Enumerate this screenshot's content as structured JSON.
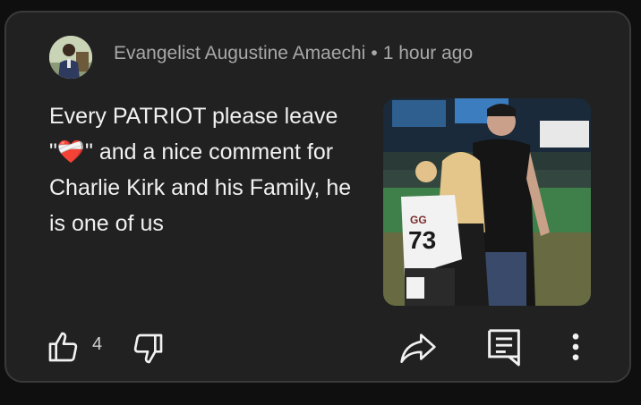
{
  "comment": {
    "author": "Evangelist Augustine Amaechi",
    "separator": "•",
    "timestamp": "1 hour ago",
    "text_before_emoji": "Every PATRIOT please leave \"",
    "emoji": "❤️‍🩹",
    "text_after_emoji": "\" and a nice comment for Charlie Kirk and his Family, he is one of us"
  },
  "actions": {
    "like_count": "4"
  },
  "icons": {
    "like": "thumbs-up-icon",
    "dislike": "thumbs-down-icon",
    "share": "share-arrow-icon",
    "reply": "reply-comment-icon",
    "more": "more-vertical-icon"
  },
  "colors": {
    "card_background": "#212121",
    "card_border": "#3a3a3a",
    "page_background": "#0f0f0f",
    "meta_text": "#a8a8a8",
    "body_text": "#f1f1f1"
  }
}
